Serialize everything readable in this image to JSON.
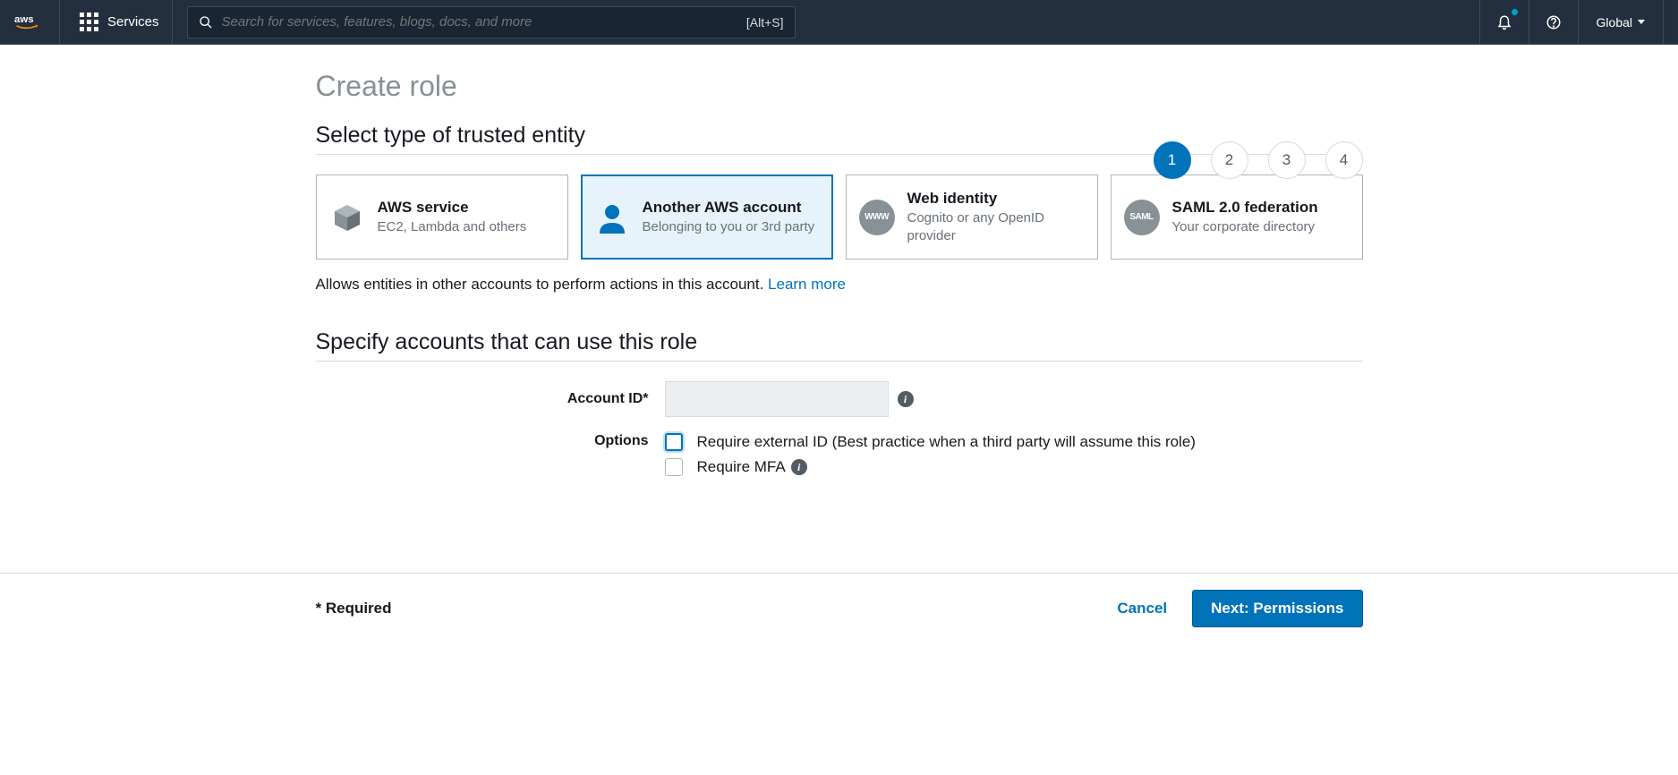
{
  "nav": {
    "services_label": "Services",
    "search_placeholder": "Search for services, features, blogs, docs, and more",
    "search_hint": "[Alt+S]",
    "region": "Global"
  },
  "page": {
    "title": "Create role",
    "section1_title": "Select type of trusted entity",
    "section2_title": "Specify accounts that can use this role",
    "description": "Allows entities in other accounts to perform actions in this account. ",
    "learn_more": "Learn more"
  },
  "steps": [
    "1",
    "2",
    "3",
    "4"
  ],
  "active_step": 1,
  "entity_cards": [
    {
      "title": "AWS service",
      "subtitle": "EC2, Lambda and others",
      "selected": false
    },
    {
      "title": "Another AWS account",
      "subtitle": "Belonging to you or 3rd party",
      "selected": true
    },
    {
      "title": "Web identity",
      "subtitle": "Cognito or any OpenID provider",
      "selected": false,
      "badge": "WWW"
    },
    {
      "title": "SAML 2.0 federation",
      "subtitle": "Your corporate directory",
      "selected": false,
      "badge": "SAML"
    }
  ],
  "form": {
    "account_id_label": "Account ID*",
    "account_id_value": "",
    "options_label": "Options",
    "option_external_id": "Require external ID (Best practice when a third party will assume this role)",
    "option_mfa": "Require MFA"
  },
  "footer": {
    "required_note": "* Required",
    "cancel": "Cancel",
    "next": "Next: Permissions"
  }
}
